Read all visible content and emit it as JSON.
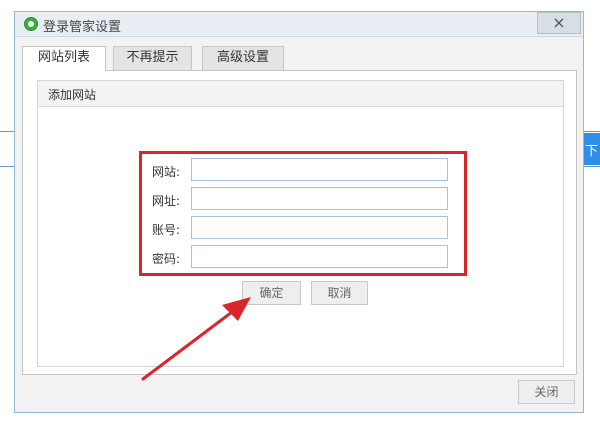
{
  "window": {
    "title": "登录管家设置",
    "close_glyph": "×"
  },
  "tabs": [
    {
      "label": "网站列表",
      "active": true
    },
    {
      "label": "不再提示",
      "active": false
    },
    {
      "label": "高级设置",
      "active": false
    }
  ],
  "group": {
    "title": "添加网站"
  },
  "form": {
    "fields": [
      {
        "label": "网站:",
        "value": ""
      },
      {
        "label": "网址:",
        "value": ""
      },
      {
        "label": "账号:",
        "value": ""
      },
      {
        "label": "密码:",
        "value": ""
      }
    ],
    "confirm_label": "确定",
    "cancel_label": "取消"
  },
  "footer": {
    "close_label": "关闭"
  },
  "background": {
    "next_label": "下"
  },
  "colors": {
    "highlight": "#d8262b",
    "accent": "#2f8ee6"
  }
}
